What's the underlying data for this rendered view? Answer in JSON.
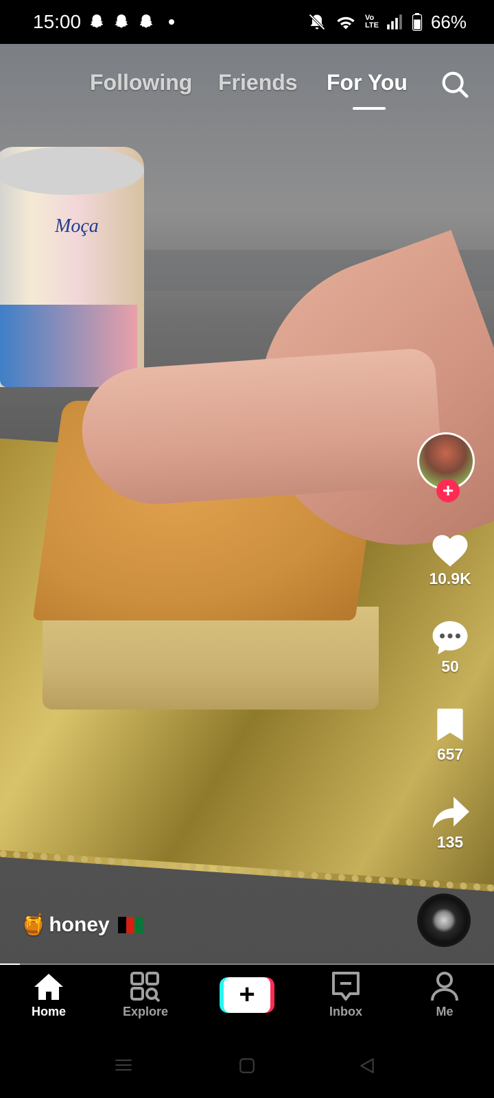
{
  "status_bar": {
    "time": "15:00",
    "battery": "66%",
    "icons": [
      "snapchat-ghost-icon",
      "snapchat-ghost-icon",
      "snapchat-ghost-icon",
      "notification-dot",
      "bell-muted-icon",
      "wifi-icon",
      "volte-icon",
      "signal-icon",
      "battery-icon"
    ],
    "volte_label": "Vo\nLTE"
  },
  "top_nav": {
    "tabs": [
      {
        "label": "Following",
        "active": false
      },
      {
        "label": "Friends",
        "active": false
      },
      {
        "label": "For You",
        "active": true
      }
    ],
    "search_icon": "search-icon"
  },
  "video": {
    "product_label": "Moça",
    "progress": 0.04
  },
  "actions": {
    "avatar_icon": "creator-avatar",
    "follow_icon": "plus-icon",
    "likes": "10.9K",
    "comments": "50",
    "bookmarks": "657",
    "shares": "135"
  },
  "caption": {
    "emoji": "🍯",
    "username": "honey",
    "flag": "afghanistan-flag"
  },
  "bottom_nav": {
    "items": [
      {
        "label": "Home",
        "icon": "home-icon",
        "active": true
      },
      {
        "label": "Explore",
        "icon": "explore-icon",
        "active": false
      },
      {
        "label": "",
        "icon": "create-plus-icon",
        "active": false
      },
      {
        "label": "Inbox",
        "icon": "inbox-icon",
        "active": false
      },
      {
        "label": "Me",
        "icon": "profile-icon",
        "active": false
      }
    ],
    "create_symbol": "+"
  },
  "colors": {
    "accent_red": "#fe2c55",
    "accent_cyan": "#25f4ee"
  }
}
